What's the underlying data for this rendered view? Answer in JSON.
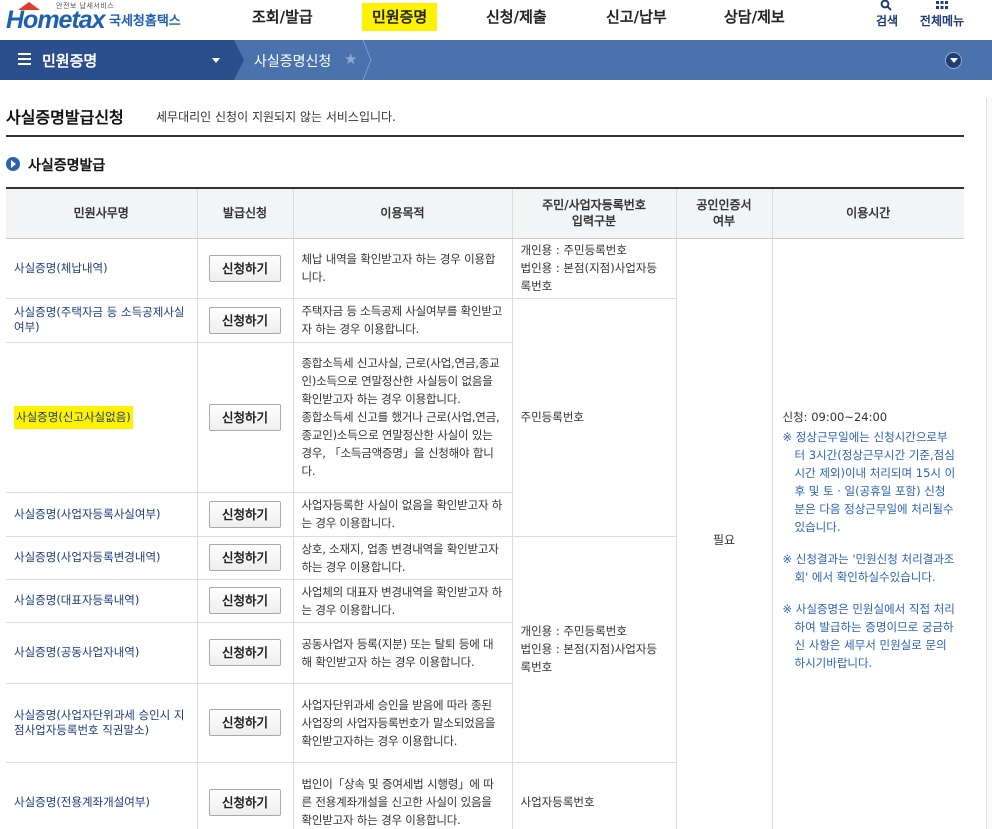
{
  "header": {
    "logo_small": "안전보 납세서비스",
    "logo_brand": "Hometax",
    "logo_korean": "국세청홈택스",
    "menu": [
      {
        "label": "조회/발급",
        "active": false
      },
      {
        "label": "민원증명",
        "active": true
      },
      {
        "label": "신청/제출",
        "active": false
      },
      {
        "label": "신고/납부",
        "active": false
      },
      {
        "label": "상담/제보",
        "active": false
      }
    ],
    "search_label": "검색",
    "all_menu_label": "전체메뉴"
  },
  "nav": {
    "section": "민원증명",
    "crumb": "사실증명신청",
    "star_icon": "star-icon",
    "colors": {
      "bar": "#4a73ae",
      "dark": "#2a4f8c"
    }
  },
  "page": {
    "title": "사실증명발급신청",
    "notice": "세무대리인 신청이 지원되지 않는 서비스입니다.",
    "section_title": "사실증명발급"
  },
  "table": {
    "headers": [
      "민원사무명",
      "발급신청",
      "이용목적",
      "주민/사업자등록번호\n입력구분",
      "공인인증서\n여부",
      "이용시간"
    ],
    "apply_label": "신청하기",
    "rows": [
      {
        "name": "사실증명(체납내역)",
        "purpose": "체납 내역을 확인받고자 하는 경우 이용합니다."
      },
      {
        "name": "사실증명(주택자금 등 소득공제사실여부)",
        "purpose": "주택자금 등 소득공제 사실여부를 확인받고자 하는 경우 이용합니다."
      },
      {
        "name": "사실증명(신고사실없음)",
        "purpose": "종합소득세 신고사실, 근로(사업,연금,종교인)소득으로 연말정산한 사실등이 없음을 확인받고자 하는 경우 이용합니다.\n종합소득세 신고를 했거나 근로(사업,연금,종교인)소득으로 연말정산한 사실이 있는 경우, 「소득금액증명」을 신청해야 합니다.",
        "highlight": true
      },
      {
        "name": "사실증명(사업자등록사실여부)",
        "purpose": "사업자등록한 사실이 없음을 확인받고자 하는 경우 이용합니다."
      },
      {
        "name": "사실증명(사업자등록변경내역)",
        "purpose": "상호, 소재지, 업종 변경내역을 확인받고자 하는 경우 이용합니다."
      },
      {
        "name": "사실증명(대표자등록내역)",
        "purpose": "사업체의 대표자 변경내역을 확인받고자 하는 경우 이용합니다."
      },
      {
        "name": "사실증명(공동사업자내역)",
        "purpose": "공동사업자 등록(지분) 또는 탈퇴 등에 대해 확인받고자 하는 경우 이용합니다."
      },
      {
        "name": "사실증명(사업자단위과세 승인시 지점사업자등록번호 직권말소)",
        "purpose": "사업자단위과세 승인을 받음에 따라 종된 사업장의 사업자등록번호가 말소되었음을 확인받고자하는 경우 이용합니다."
      },
      {
        "name": "사실증명(전용계좌개설여부)",
        "purpose": "법인이「상속 및 증여세법 시행령」에 따른 전용계좌개설을 신고한 사실이 있음을 확인받고자 하는 경우 이용합니다."
      }
    ],
    "idtypes": {
      "g1": "개인용 : 주민등록번호\n법인용 : 본점(지점)사업자등록번호",
      "g2": "주민등록번호",
      "g3": "개인용 : 주민등록번호\n법인용 : 본점(지점)사업자등록번호",
      "g4": "사업자등록번호"
    },
    "cert": "필요",
    "usetime": {
      "apply_time": "신청: 09:00~24:00",
      "notes": [
        "※ 정상근무일에는 신청시간으로부터 3시간(정상근무시간 기준,점심시간 제외)이내 처리되며 15시 이후 및 토 · 일(공휴일 포함) 신청분은 다음 정상근무일에 처리될수있습니다.",
        "※ 신청결과는 '민원신청 처리결과조회' 에서 확인하실수있습니다.",
        "※ 사실증명은 민원실에서 직접 처리하여 발급하는 증명이므로 궁금하신 사항은 세무서 민원실로 문의하시기바랍니다."
      ]
    }
  }
}
